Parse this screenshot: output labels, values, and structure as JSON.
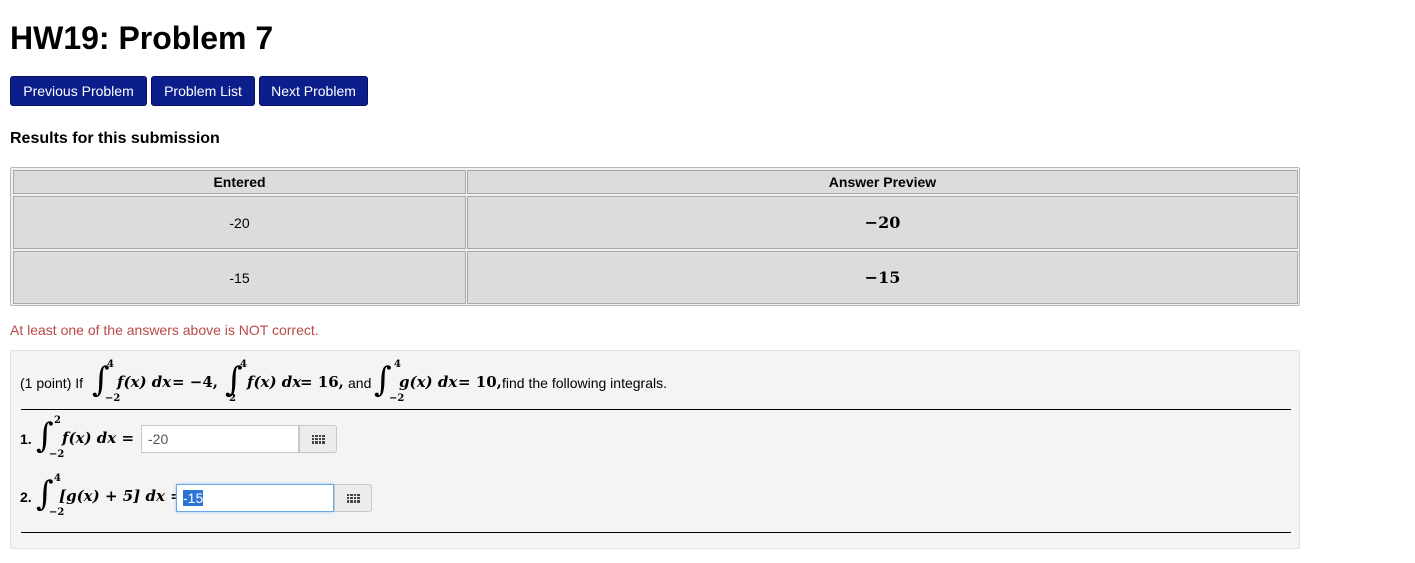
{
  "page": {
    "title": "HW19: Problem 7"
  },
  "nav": {
    "previous": "Previous Problem",
    "list": "Problem List",
    "next": "Next Problem"
  },
  "results": {
    "heading": "Results for this submission",
    "columns": [
      "Entered",
      "Answer Preview"
    ],
    "rows": [
      {
        "entered": "-20",
        "preview": "−20"
      },
      {
        "entered": "-15",
        "preview": "−15"
      }
    ],
    "message": "At least one of the answers above is NOT correct.",
    "message_color": "#b94a48"
  },
  "problem": {
    "points": "(1 point) If",
    "given": [
      {
        "upper": "4",
        "lower": "−2",
        "integrand": "f(x) dx",
        "value": "= −4,",
        "after": ""
      },
      {
        "upper": "4",
        "lower": "2",
        "integrand": "f(x) dx",
        "value": "= 16,",
        "after": "and"
      },
      {
        "upper": "4",
        "lower": "−2",
        "integrand": "g(x) dx",
        "value": "= 10,",
        "after": "find the following integrals."
      }
    ],
    "parts": [
      {
        "label": "1.",
        "upper": "2",
        "lower": "−2",
        "integrand": "f(x) dx =",
        "answer": "-20",
        "focused": false
      },
      {
        "label": "2.",
        "upper": "4",
        "lower": "−2",
        "integrand": "[g(x) + 5] dx =",
        "answer": "-15",
        "focused": true
      }
    ],
    "keyboard_icon": "keyboard-grid-icon"
  },
  "colors": {
    "button_bg": "#0b1e8c",
    "focus_border": "#66a8e8"
  }
}
